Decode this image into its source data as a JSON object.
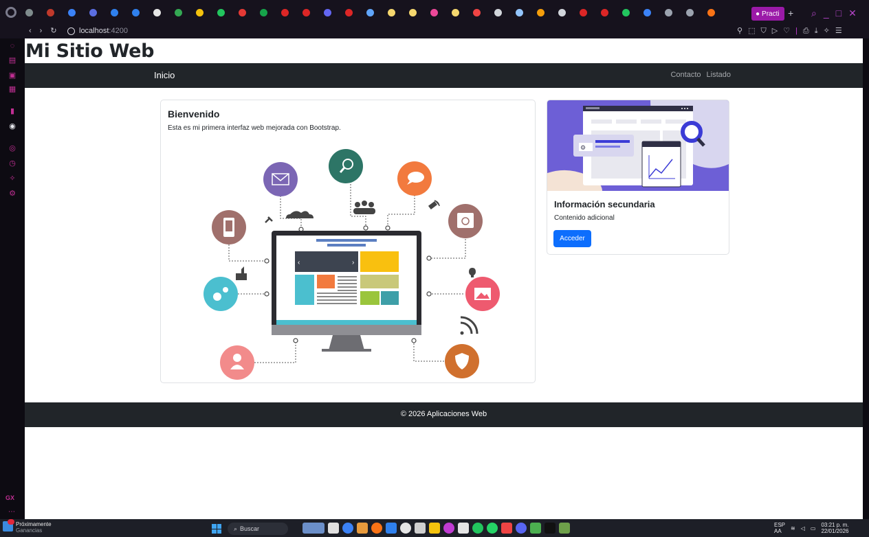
{
  "browser": {
    "active_tab_label": "Practi",
    "new_tab_symbol": "+",
    "url_host": "localhost",
    "url_port": ":4200",
    "tab_icon_colors": [
      "#7f8c8d",
      "#c0392b",
      "#3b82f6",
      "#5b6ee1",
      "#2f80ed",
      "#2f80ed",
      "#e6e6e6",
      "#34a853",
      "#f4c20d",
      "#22c55e",
      "#e53935",
      "#16a34a",
      "#dc2626",
      "#dc2626",
      "#6366f1",
      "#dc2626",
      "#60a5fa",
      "#f5d76e",
      "#f5d76e",
      "#ec4899",
      "#f5d76e",
      "#ef4444",
      "#d1d5db",
      "#93c5fd",
      "#f59e0b",
      "#d1d5db",
      "#dc2626",
      "#dc2626",
      "#22c55e",
      "#3b82f6",
      "#9ca3af",
      "#9ca3af",
      "#f97316"
    ]
  },
  "page": {
    "site_title": "Mi Sitio Web",
    "nav": {
      "brand": "Inicio",
      "links": [
        "Contacto",
        "Listado"
      ]
    },
    "main_card": {
      "title": "Bienvenido",
      "text": "Esta es mi primera interfaz web mejorada con Bootstrap."
    },
    "side_card": {
      "title": "Información secundaria",
      "text": "Contenido adicional",
      "button_label": "Acceder"
    },
    "footer": "© 2026 Aplicaciones Web"
  },
  "taskbar": {
    "widget_title": "Próximamente",
    "widget_subtitle": "Ganancias",
    "widget_badge": "",
    "search_label": "Buscar",
    "lang_top": "ESP",
    "lang_bottom": "AA",
    "time": "03:21 p. m.",
    "date": "22/01/2026"
  },
  "colors": {
    "navbar": "#212529",
    "primary": "#0d6efd",
    "browser_accent": "#9b1aa8",
    "illustration_purple": "#6d5fd6"
  }
}
